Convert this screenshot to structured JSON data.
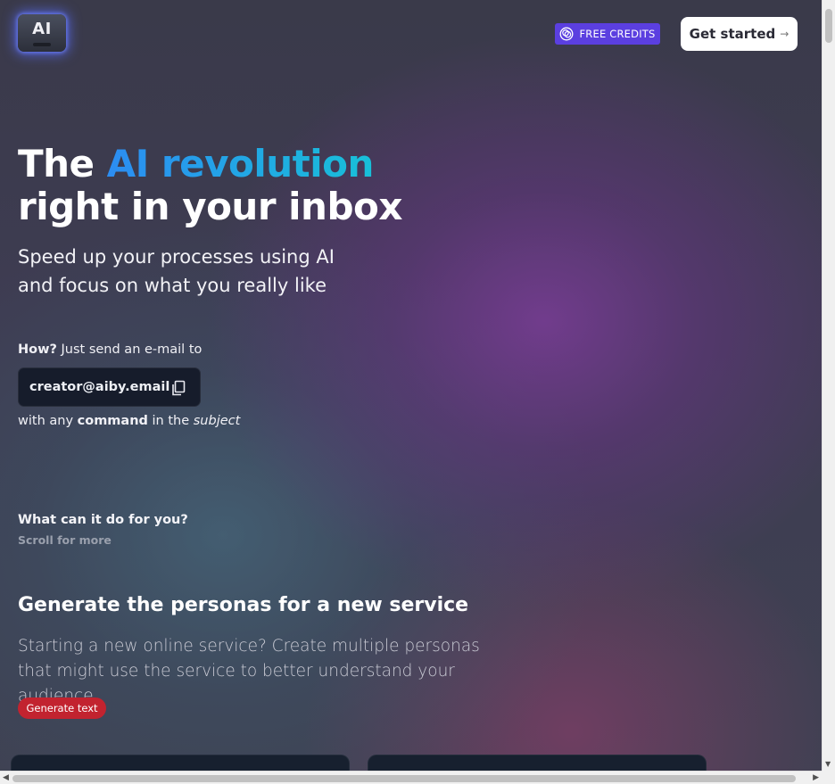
{
  "header": {
    "logo_text": "AI",
    "free_credits_label": "FREE CREDITS",
    "free_credits_icon": "coins-icon",
    "get_started_label": "Get started",
    "get_started_arrow": "→"
  },
  "hero": {
    "title_prefix": "The ",
    "title_accent": "AI revolution",
    "title_line2": "right in your inbox",
    "subtitle_line1": "Speed up your processes using AI",
    "subtitle_line2": "and focus on what you really like",
    "how_bold": "How?",
    "how_text": " Just send an e-mail to",
    "email": "creator@aiby.email",
    "command_prefix": "with any ",
    "command_bold": "command",
    "command_middle": " in the ",
    "command_italic": "subject"
  },
  "features_intro": {
    "heading": "What can it do for you?",
    "hint": "Scroll for more"
  },
  "feature": {
    "title": "Generate the personas for a new service",
    "description": "Starting a new online service? Create multiple personas that might use the service to better understand your audience",
    "button_label": "Generate text"
  },
  "colors": {
    "accent_gradient_start": "#2c8df2",
    "accent_gradient_end": "#18c0d8",
    "free_credits_bg": "#5b3fe0",
    "generate_button_bg": "#c2232f",
    "email_box_bg": "#161c2b"
  }
}
